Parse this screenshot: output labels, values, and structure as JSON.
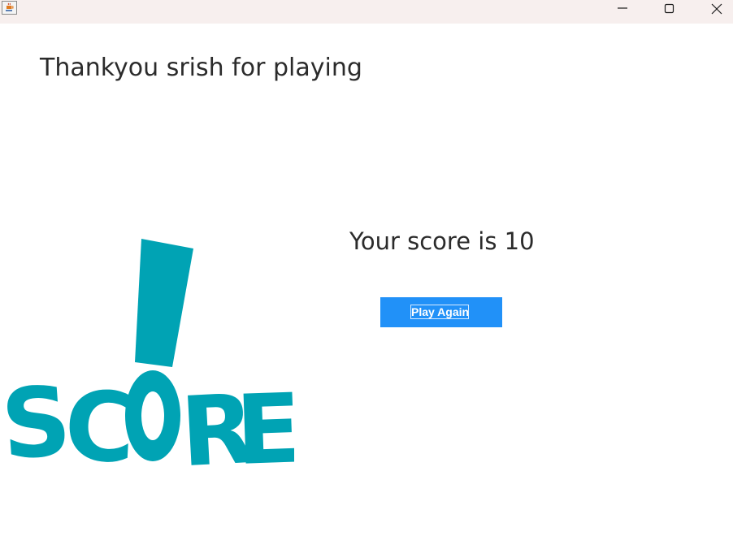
{
  "window": {
    "controls": {
      "minimize": "minimize",
      "maximize": "maximize",
      "close": "close"
    }
  },
  "main": {
    "thanks_message": "Thankyou srish for playing",
    "score_message": "Your score is 10",
    "play_again_label": "Play Again"
  },
  "logo": {
    "letters": [
      "S",
      "C",
      "R",
      "E"
    ],
    "color": "#00a3b4"
  },
  "colors": {
    "button_bg": "#2191f8",
    "titlebar_bg": "#f7efee",
    "text": "#2b2b2b"
  }
}
